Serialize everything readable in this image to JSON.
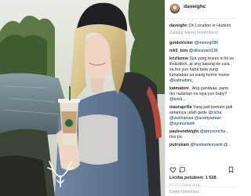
{
  "post": {
    "username": "daveighc",
    "caption_user": "daveighc",
    "caption": "On Location in Hudson",
    "load_more": "Załaduj więcej komentarzy",
    "likes_label": "Liczba polubień:",
    "likes_count": "1 528",
    "date": "23 STYCZNIA 2016",
    "add_comment_placeholder": "Dodaj komentarz..."
  },
  "comments": [
    {
      "user": "goldstricker",
      "text": "",
      "mention": "@meneg086"
    },
    {
      "user": "mk5_tom",
      "text": "",
      "mention": "@olliesmart136"
    },
    {
      "user": "krizliemw",
      "text": "Sya yung boses ni lili sa lilo&stitch, at ang batang de-cola sa fox yun haha bsta yung lumalabas sa isang horror movie",
      "mention": "@katmabini_"
    },
    {
      "user": "katmabini_",
      "text": "Ang gandaaa, pano mo nalaman na siya yun baby?",
      "mention": "@krizli..."
    },
    {
      "user": "mauraprilla",
      "text": "Yang jadi pemain jadi setannya udah gede",
      "mention": "@richa @viskhaniaa @arsetyadewi @ayunuriasih"
    },
    {
      "user": "pauleendwight",
      "text": "",
      "mention": "@greysoncha... this pic"
    },
    {
      "user": "putrizkam",
      "text": "",
      "mention": "@hestiardesyanti @..."
    }
  ],
  "icons": {
    "like": "heart-icon",
    "comment": "comment-icon",
    "save": "bookmark-icon",
    "photo_logo": "deer-antler-logo"
  }
}
